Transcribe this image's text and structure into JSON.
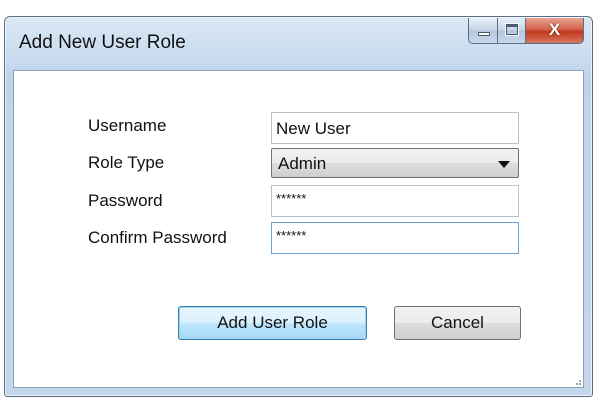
{
  "window": {
    "title": "Add New User Role",
    "close_glyph": "X"
  },
  "form": {
    "username_label": "Username",
    "username_value": "New User",
    "role_type_label": "Role Type",
    "role_type_value": "Admin",
    "password_label": "Password",
    "password_value": "******",
    "confirm_password_label": "Confirm Password",
    "confirm_password_value": "******"
  },
  "buttons": {
    "add_label": "Add User Role",
    "cancel_label": "Cancel"
  },
  "icons": {
    "minimize": "minimize-icon",
    "maximize": "maximize-icon",
    "close": "close-icon",
    "dropdown": "chevron-down-icon",
    "resize_grip": "resize-grip-icon"
  }
}
